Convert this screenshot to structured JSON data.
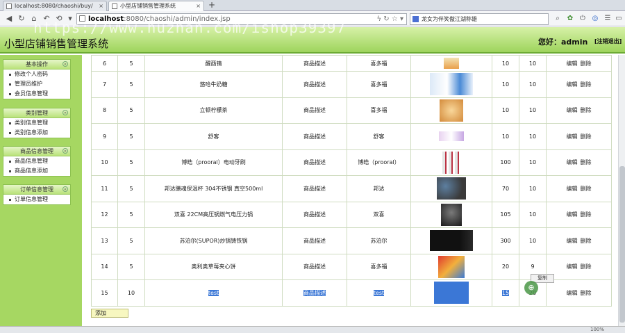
{
  "browser": {
    "tabs": [
      {
        "title": "localhost:8080/chaoshi/buy/"
      },
      {
        "title": "小型店铺销售管理系统"
      }
    ],
    "new_tab": "+",
    "url_host": "localhost",
    "url_rest": ":8080/chaoshi/admin/index.jsp",
    "search_text": "龙女为伴笑傲江湖称雄"
  },
  "watermark": "https://www.huzhan.com/ishop39397",
  "header": {
    "title": "小型店铺销售管理系统",
    "greeting": "您好：admin",
    "logout": "[注销退出]"
  },
  "sidebar": {
    "groups": [
      {
        "title": "基本操作",
        "items": [
          "修改个人密码",
          "管理员维护",
          "会员信息管理"
        ]
      },
      {
        "title": "类别管理",
        "items": [
          "类别信息管理",
          "类别信息添加"
        ]
      },
      {
        "title": "商品信息管理",
        "items": [
          "商品信息管理",
          "商品信息添加"
        ]
      },
      {
        "title": "订单信息管理",
        "items": [
          "订单信息管理"
        ]
      }
    ]
  },
  "table": {
    "rows": [
      {
        "id": "6",
        "cat": "5",
        "name": "醒酉锖",
        "desc": "商品描述",
        "brand": "喜多福",
        "img": "snack",
        "price": "10",
        "stock": "10",
        "edit": "编辑",
        "del": "删除"
      },
      {
        "id": "7",
        "cat": "5",
        "name": "悠哈牛奶糖",
        "desc": "商品描述",
        "brand": "喜多福",
        "img": "milk-candy",
        "price": "10",
        "stock": "10",
        "edit": "编辑",
        "del": "删除"
      },
      {
        "id": "8",
        "cat": "5",
        "name": "立顿柠檬茶",
        "desc": "商品描述",
        "brand": "喜多福",
        "img": "lemon-tea",
        "price": "10",
        "stock": "10",
        "edit": "编辑",
        "del": "删除"
      },
      {
        "id": "9",
        "cat": "5",
        "name": "舒客",
        "desc": "商品描述",
        "brand": "舒客",
        "img": "toothpaste",
        "price": "10",
        "stock": "10",
        "edit": "编辑",
        "del": "删除"
      },
      {
        "id": "10",
        "cat": "5",
        "name": "博皓（prooral）电动牙刷",
        "desc": "商品描述",
        "brand": "博皓（prooral）",
        "img": "toothbrush",
        "price": "100",
        "stock": "10",
        "edit": "编辑",
        "del": "删除"
      },
      {
        "id": "11",
        "cat": "5",
        "name": "邦达膳魂保温杯 304不锈钢 真空500ml",
        "desc": "商品描述",
        "brand": "邦达",
        "img": "bowls",
        "price": "70",
        "stock": "10",
        "edit": "编辑",
        "del": "删除"
      },
      {
        "id": "12",
        "cat": "5",
        "name": "双喜 22CM高压锅燃气电压力锅",
        "desc": "商品描述",
        "brand": "双喜",
        "img": "pressure-cooker",
        "price": "105",
        "stock": "10",
        "edit": "编辑",
        "del": "删除"
      },
      {
        "id": "13",
        "cat": "5",
        "name": "苏泊尔(SUPOR)炒锅铸铁锅",
        "desc": "商品描述",
        "brand": "苏泊尔",
        "img": "microwave",
        "price": "300",
        "stock": "10",
        "edit": "编辑",
        "del": "删除"
      },
      {
        "id": "14",
        "cat": "5",
        "name": "奥利奥草莓夹心饼",
        "desc": "商品描述",
        "brand": "喜多福",
        "img": "cookies",
        "price": "20",
        "stock": "9",
        "edit": "编辑",
        "del": "删除"
      },
      {
        "id": "15",
        "cat": "10",
        "name": "test",
        "desc": "商品描述",
        "brand": "test",
        "img": "selected-blue",
        "price": "15",
        "stock": "20",
        "edit": "编辑",
        "del": "删除",
        "selected": true
      }
    ]
  },
  "add_button": "添加",
  "copy_tooltip": "复制",
  "statusbar": {
    "zoom": "100%"
  }
}
